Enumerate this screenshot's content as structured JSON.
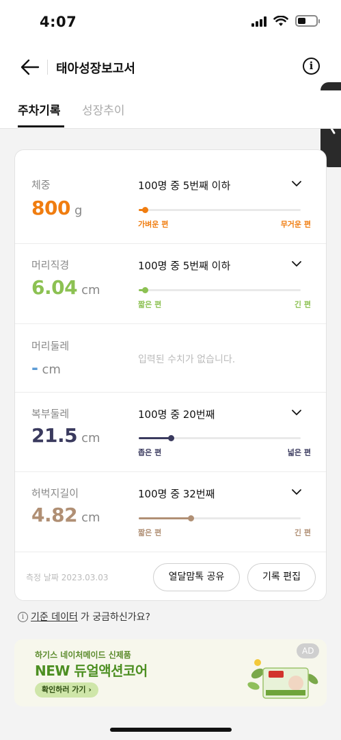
{
  "status_bar": {
    "time": "4:07"
  },
  "header": {
    "title": "태아성장보고서",
    "info_icon": "i"
  },
  "tabs": [
    {
      "label": "주차기록",
      "active": true
    },
    {
      "label": "성장추이",
      "active": false
    }
  ],
  "measurements": [
    {
      "label": "체중",
      "value": "800",
      "unit": "g",
      "rank": "100명 중 5번째 이하",
      "color": "#f07d10",
      "percent": 4,
      "low_label": "가벼운 편",
      "high_label": "무거운 편"
    },
    {
      "label": "머리직경",
      "value": "6.04",
      "unit": "cm",
      "rank": "100명 중 5번째 이하",
      "color": "#8cc152",
      "percent": 4,
      "low_label": "짧은 편",
      "high_label": "긴 편"
    },
    {
      "label": "머리둘레",
      "value": "-",
      "unit": "cm",
      "color": "#5b9bd5",
      "empty_message": "입력된 수치가 없습니다."
    },
    {
      "label": "복부둘레",
      "value": "21.5",
      "unit": "cm",
      "rank": "100명 중 20번째",
      "color": "#3a3a5e",
      "percent": 20,
      "low_label": "좁은 편",
      "high_label": "넓은 편"
    },
    {
      "label": "허벅지길이",
      "value": "4.82",
      "unit": "cm",
      "rank": "100명 중 32번째",
      "color": "#b08f74",
      "percent": 32,
      "low_label": "짧은 편",
      "high_label": "긴 편"
    }
  ],
  "footer": {
    "date": "측정 날짜 2023.03.03",
    "share_button": "열달맘톡 공유",
    "edit_button": "기록 편집"
  },
  "help": {
    "icon": "i",
    "link": "기준 데이터",
    "suffix": "가 궁금하신가요?"
  },
  "ad": {
    "subtitle": "하기스 네이처메이드 신제품",
    "title": "NEW 듀얼액션코어",
    "cta": "확인하러 가기",
    "badge": "AD"
  }
}
